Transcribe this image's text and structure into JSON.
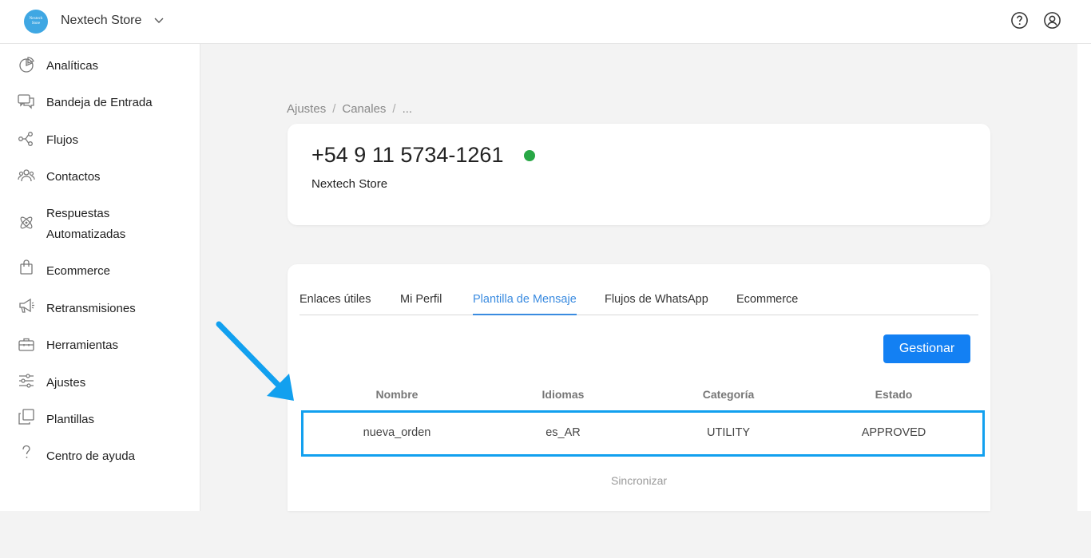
{
  "header": {
    "logo_text": [
      "Nextech",
      "Store"
    ],
    "store_name": "Nextech Store"
  },
  "sidebar": {
    "items": [
      {
        "label": "Analíticas",
        "icon": "pie-chart-icon"
      },
      {
        "label": "Bandeja de Entrada",
        "icon": "chat-bubbles-icon"
      },
      {
        "label": "Flujos",
        "icon": "flow-nodes-icon"
      },
      {
        "label": "Contactos",
        "icon": "contacts-icon"
      },
      {
        "label": "Respuestas Automatizadas",
        "label_lines": [
          "Respuestas",
          "Automatizadas"
        ],
        "icon": "atom-icon"
      },
      {
        "label": "Ecommerce",
        "icon": "shopping-bag-icon"
      },
      {
        "label": "Retransmisiones",
        "icon": "megaphone-icon"
      },
      {
        "label": "Herramientas",
        "icon": "toolbox-icon"
      },
      {
        "label": "Ajustes",
        "icon": "sliders-icon"
      },
      {
        "label": "Plantillas",
        "icon": "copy-icon"
      },
      {
        "label": "Centro de ayuda",
        "icon": "question-icon"
      }
    ]
  },
  "breadcrumb": [
    "Ajustes",
    "Canales",
    "..."
  ],
  "channel": {
    "phone": "+54 9 11 5734-1261",
    "status_color": "#28a745",
    "name": "Nextech Store"
  },
  "tabs": [
    {
      "label": "Enlaces útiles",
      "active": false
    },
    {
      "label": "Mi Perfil",
      "active": false
    },
    {
      "label": "Plantilla de Mensaje",
      "active": true
    },
    {
      "label": "Flujos de WhatsApp",
      "active": false
    },
    {
      "label": "Ecommerce",
      "active": false
    }
  ],
  "manage_button": "Gestionar",
  "table": {
    "headers": [
      "Nombre",
      "Idiomas",
      "Categoría",
      "Estado"
    ],
    "rows": [
      [
        "nueva_orden",
        "es_AR",
        "UTILITY",
        "APPROVED"
      ]
    ]
  },
  "sync_label": "Sincronizar",
  "colors": {
    "accent": "#1380f3",
    "active_tab": "#3a8be0",
    "highlight": "#12a0ef"
  }
}
